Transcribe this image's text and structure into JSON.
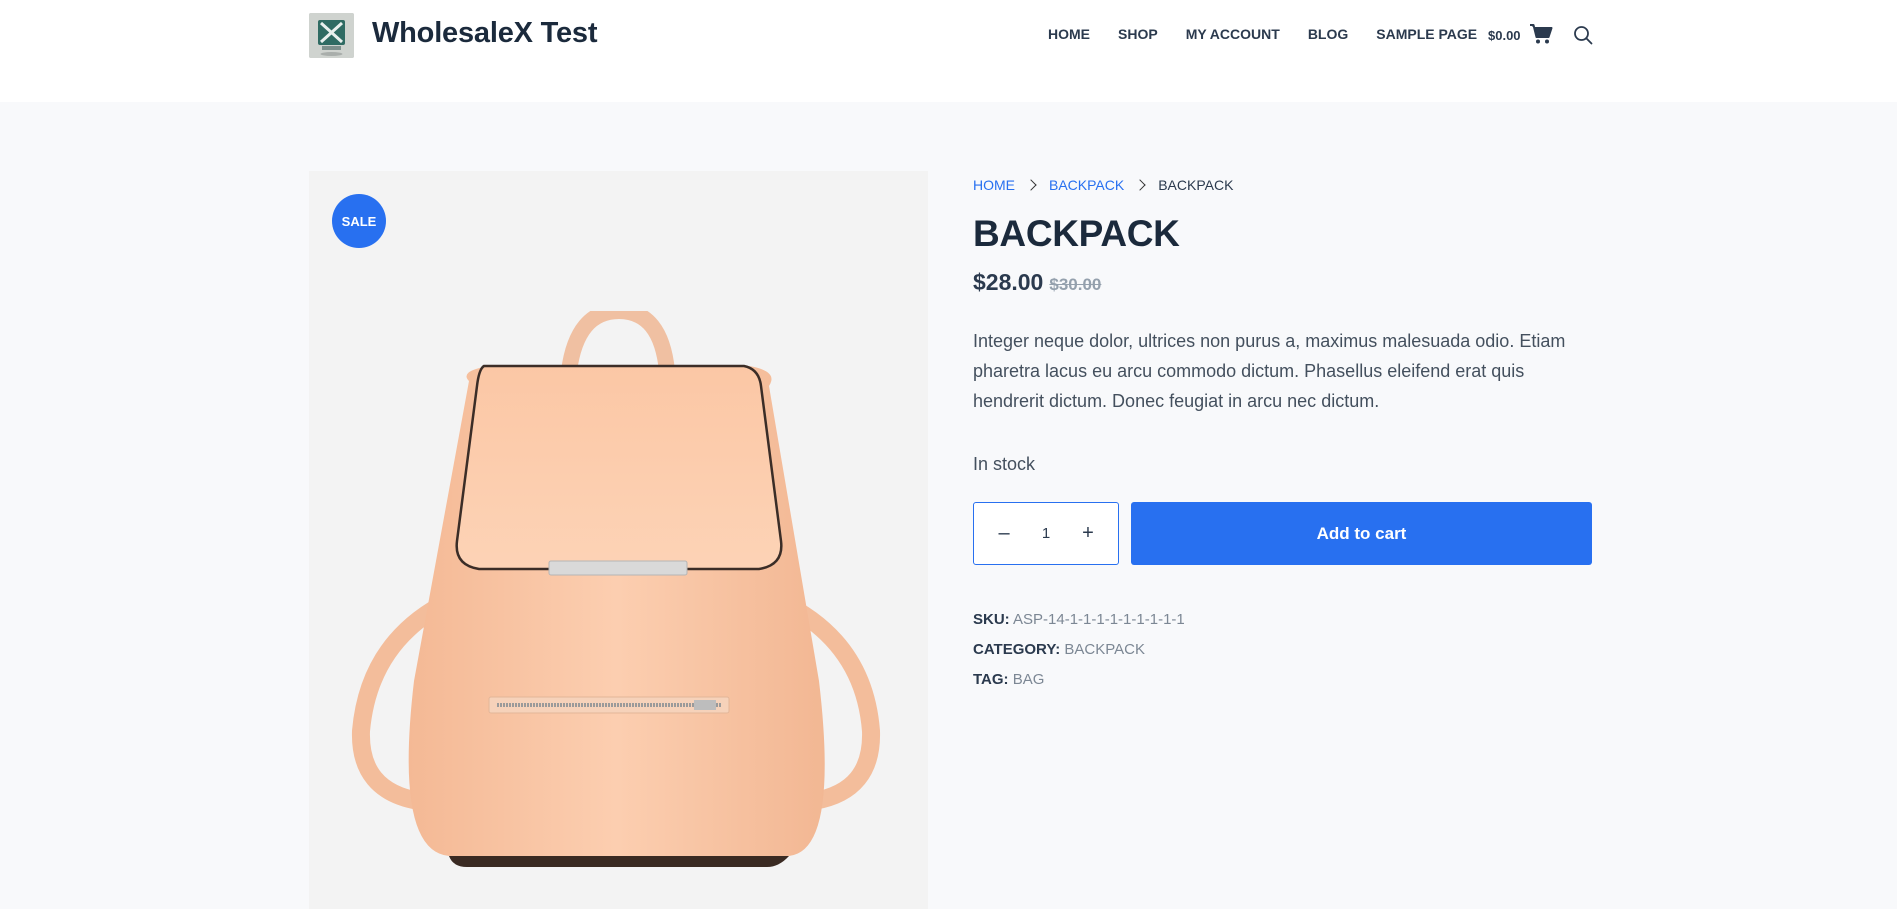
{
  "header": {
    "site_title": "WholesaleX Test",
    "nav": [
      "HOME",
      "SHOP",
      "MY ACCOUNT",
      "BLOG",
      "SAMPLE PAGE"
    ],
    "cart_amount": "$0.00"
  },
  "product": {
    "sale_badge": "SALE",
    "breadcrumb": [
      "HOME",
      "BACKPACK",
      "BACKPACK"
    ],
    "title": "BACKPACK",
    "price_now": "$28.00",
    "price_old": "$30.00",
    "description": "Integer neque dolor, ultrices non purus a, maximus malesuada odio. Etiam pharetra lacus eu arcu commodo dictum. Phasellus eleifend erat quis hendrerit dictum. Donec feugiat in arcu nec dictum.",
    "stock": "In stock",
    "quantity": "1",
    "qty_minus": "–",
    "qty_plus": "+",
    "add_to_cart": "Add to cart",
    "meta": {
      "sku_label": "SKU:",
      "sku_value": "ASP-14-1-1-1-1-1-1-1-1-1",
      "category_label": "CATEGORY:",
      "category_value": "BACKPACK",
      "tag_label": "TAG:",
      "tag_value": "BAG"
    }
  },
  "colors": {
    "accent": "#2870f0",
    "bag": "#fbc9a8",
    "background": "#f8f9fb"
  }
}
